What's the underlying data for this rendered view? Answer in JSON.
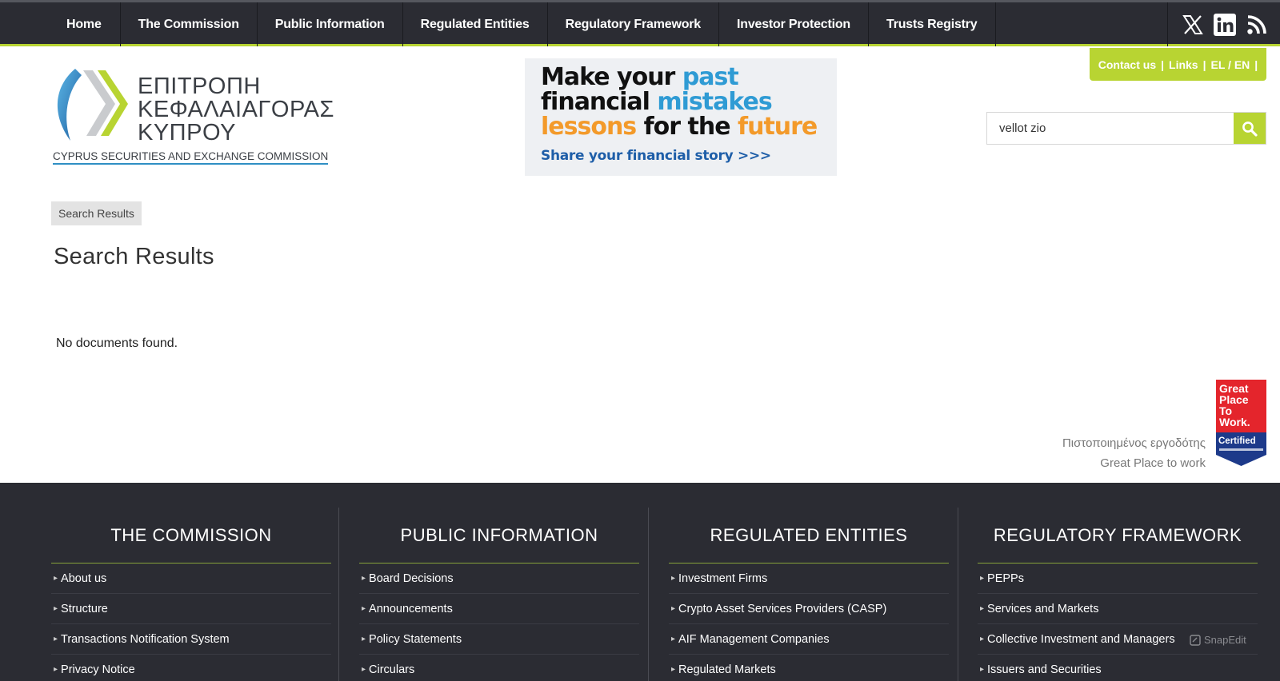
{
  "nav": {
    "items": [
      {
        "label": "Home"
      },
      {
        "label": "The Commission"
      },
      {
        "label": "Public Information"
      },
      {
        "label": "Regulated Entities"
      },
      {
        "label": "Regulatory Framework"
      },
      {
        "label": "Investor Protection"
      },
      {
        "label": "Trusts Registry"
      }
    ],
    "social": [
      "x-icon",
      "linkedin-icon",
      "rss-icon"
    ]
  },
  "header": {
    "logo_greek_1": "ΕΠΙΤΡΟΠΗ",
    "logo_greek_2": "ΚΕΦΑΛΑΙΑΓΟΡΑΣ",
    "logo_greek_3": "ΚΥΠΡΟΥ",
    "logo_english": "CYPRUS SECURITIES AND EXCHANGE COMMISSION",
    "banner": {
      "w_make": "Make your",
      "w_past": "past",
      "w_financial": "financial",
      "w_mistakes": "mistakes",
      "w_lessons": "lessons",
      "w_forthe": "for the",
      "w_future": "future",
      "share": "Share your financial story >>>"
    },
    "util": {
      "contact": "Contact us",
      "links": "Links",
      "lang": "EL / EN"
    },
    "search": {
      "value": "vellot zio"
    }
  },
  "main": {
    "breadcrumb": "Search Results",
    "title": "Search Results",
    "message": "No documents found.",
    "gptw_line1": "Πιστοποιημένος εργοδότης",
    "gptw_line2": "Great Place to work",
    "gptw_badge": {
      "l1": "Great",
      "l2": "Place",
      "l3": "To",
      "l4": "Work.",
      "l5": "Certified"
    }
  },
  "footer": {
    "columns": [
      {
        "title": "THE COMMISSION",
        "items": [
          "About us",
          "Structure",
          "Transactions Notification System",
          "Privacy Notice"
        ]
      },
      {
        "title": "PUBLIC INFORMATION",
        "items": [
          "Board Decisions",
          "Announcements",
          "Policy Statements",
          "Circulars"
        ]
      },
      {
        "title": "REGULATED ENTITIES",
        "items": [
          "Investment Firms",
          "Crypto Asset Services Providers (CASP)",
          "AIF Management Companies",
          "Regulated Markets"
        ]
      },
      {
        "title": "REGULATORY FRAMEWORK",
        "items": [
          "PEPPs",
          "Services and Markets",
          "Collective Investment and Managers",
          "Issuers and Securities"
        ]
      }
    ],
    "snapedit": "SnapEdit"
  },
  "colors": {
    "nav_bg": "#2b2c33",
    "accent_green": "#b8d432",
    "logo_blue": "#2f8fc4",
    "banner_blue": "#2f9bd4",
    "banner_orange": "#f39a2a"
  }
}
